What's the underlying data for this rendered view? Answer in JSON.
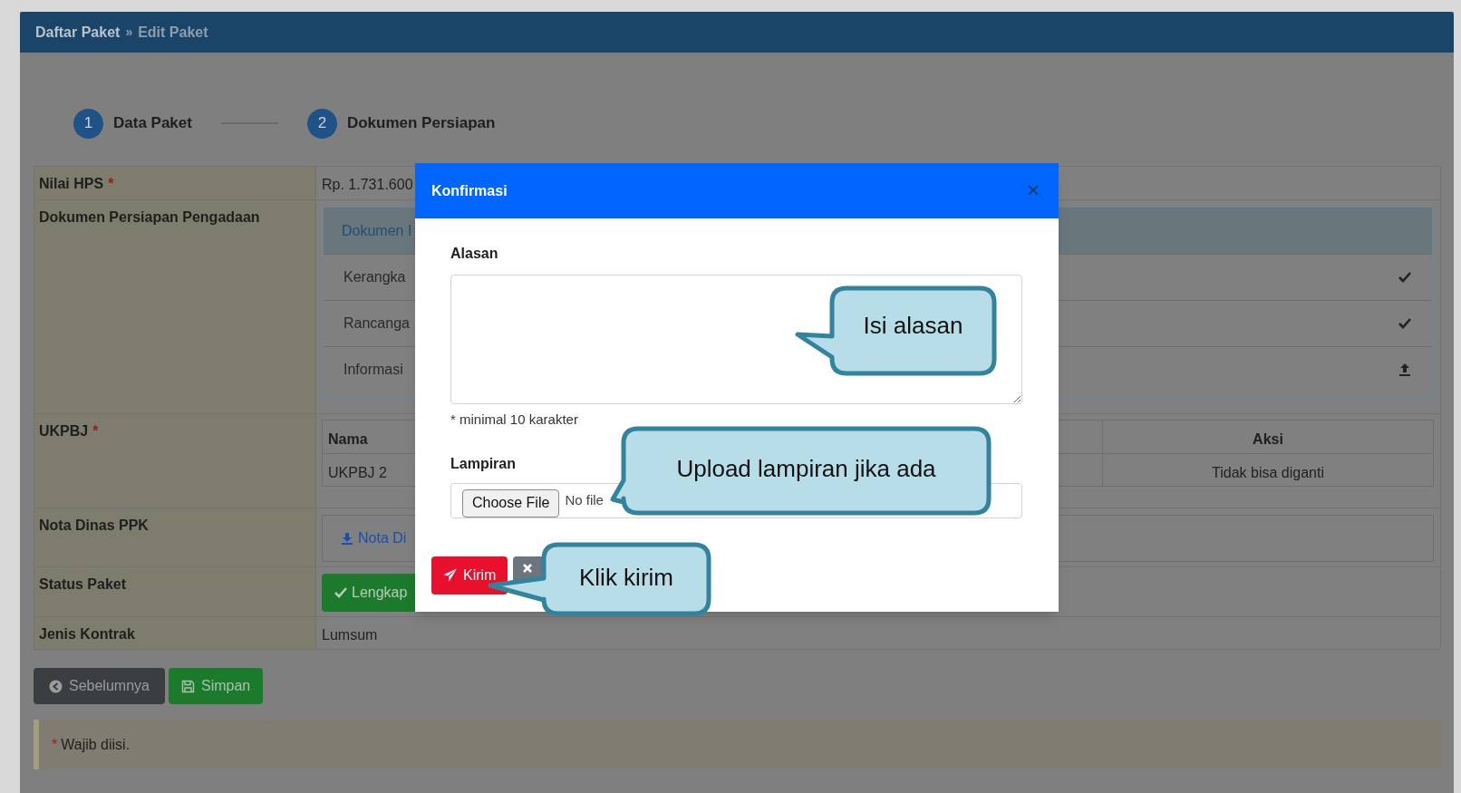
{
  "breadcrumb": {
    "items": [
      {
        "label": "Daftar Paket",
        "current": false
      },
      {
        "label": "Edit Paket",
        "current": true
      }
    ],
    "separator": "»"
  },
  "steps": [
    {
      "number": "1",
      "label": "Data Paket"
    },
    {
      "number": "2",
      "label": "Dokumen Persiapan"
    }
  ],
  "form_rows": [
    {
      "kind": "text",
      "label": "Nilai HPS",
      "required_mark": "*",
      "value": "Rp. 1.731.600"
    },
    {
      "kind": "documents",
      "label": "Dokumen Persiapan Pengadaan",
      "header": "Dokumen I",
      "items": [
        {
          "label": "Kerangka",
          "uploaded": true
        },
        {
          "label": "Rancanga",
          "uploaded": true
        },
        {
          "label": "Informasi",
          "uploaded": false
        }
      ]
    },
    {
      "kind": "table",
      "label": "UKPBJ",
      "required_mark": "*",
      "columns": [
        "Nama",
        "Aksi"
      ],
      "rows": [
        [
          "UKPBJ 2",
          "Tidak bisa diganti"
        ]
      ]
    },
    {
      "kind": "link",
      "label": "Nota Dinas PPK",
      "link": "Nota Di"
    },
    {
      "kind": "badge",
      "label": "Status Paket",
      "badge": "Lengkap"
    },
    {
      "kind": "text",
      "label": "Jenis Kontrak",
      "value": "Lumsum"
    }
  ],
  "actions": [
    {
      "kind": "back",
      "label": "Sebelumnya"
    },
    {
      "kind": "save",
      "label": "Simpan"
    }
  ],
  "note": {
    "marker": "*",
    "text": "Wajib diisi."
  },
  "modal": {
    "title": "Konfirmasi",
    "reason_label": "Alasan",
    "reason_hint": "* minimal 10 karakter",
    "attachment_label": "Lampiran",
    "choose_file": "Choose File",
    "file_status": "No file",
    "submit": "Kirim"
  },
  "callouts": [
    {
      "text": "Isi alasan"
    },
    {
      "text": "Upload lampiran jika ada"
    },
    {
      "text": "Klik kirim"
    }
  ]
}
